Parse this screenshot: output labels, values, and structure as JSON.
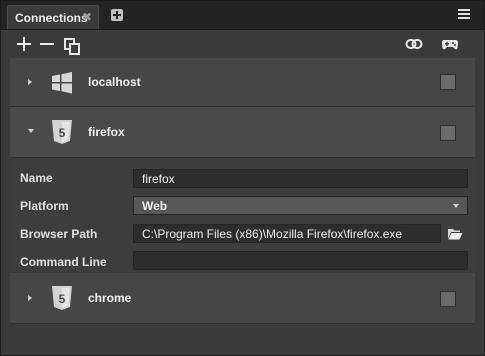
{
  "tab": {
    "label": "Connections",
    "close": "✖"
  },
  "connections": [
    {
      "label": "localhost",
      "icon": "windows-icon",
      "expanded": false
    },
    {
      "label": "firefox",
      "icon": "html5-icon",
      "expanded": true
    },
    {
      "label": "chrome",
      "icon": "html5-icon",
      "expanded": false
    }
  ],
  "details": {
    "name_label": "Name",
    "name_value": "firefox",
    "platform_label": "Platform",
    "platform_value": "Web",
    "browser_path_label": "Browser Path",
    "browser_path_value": "C:\\Program Files (x86)\\Mozilla Firefox\\firefox.exe",
    "command_line_label": "Command Line",
    "command_line_value": ""
  },
  "html5_badge": "5"
}
